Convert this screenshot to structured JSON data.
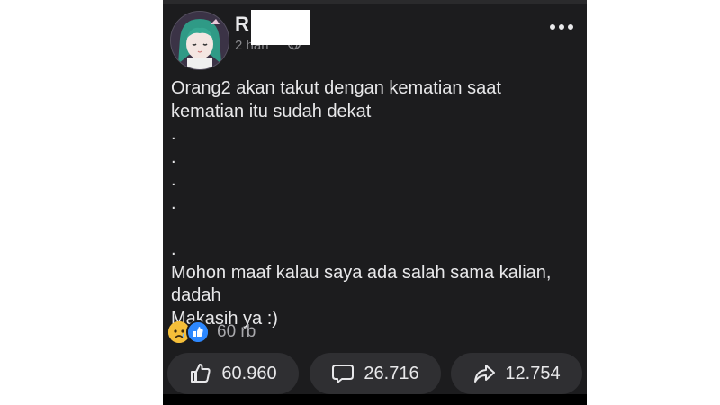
{
  "post": {
    "author_initial": "R",
    "timestamp": "2 hari",
    "privacy_icon": "globe-icon",
    "more_icon": "more-options-icon",
    "text": "Orang2 akan takut dengan kematian saat\nkematian itu sudah dekat\n.\n.\n.\n.\n\n.\nMohon maaf kalau saya ada salah sama kalian,\ndadah\nMakasih ya :)"
  },
  "reactions": {
    "icons": [
      "sad-icon",
      "like-icon"
    ],
    "count": "60 rb"
  },
  "actions": {
    "like": {
      "icon": "thumbs-up-icon",
      "count": "60.960"
    },
    "comment": {
      "icon": "comment-icon",
      "count": "26.716"
    },
    "share": {
      "icon": "share-icon",
      "count": "12.754"
    }
  },
  "colors": {
    "background": "#1c1c1e",
    "text": "#e8e8ea",
    "muted": "#8a8a8e",
    "button": "#2f2f32",
    "like_blue": "#2d88ff",
    "sad_yellow": "#f5bf3a"
  }
}
